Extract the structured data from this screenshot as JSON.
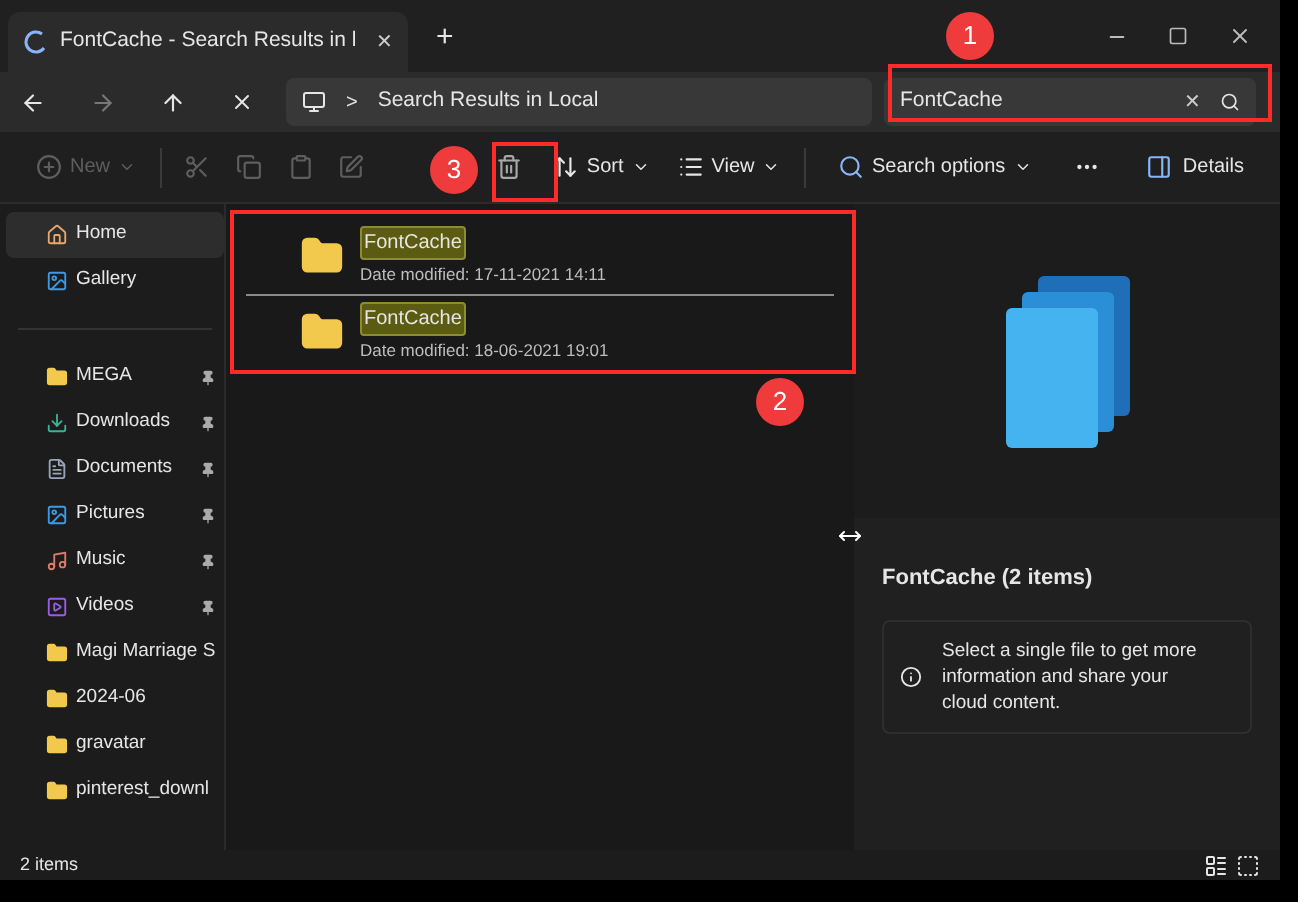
{
  "tab": {
    "title": "FontCache - Search Results in l",
    "close": "✕",
    "new_tab": "+"
  },
  "address": {
    "path": "Search Results in Local",
    "separator": ">"
  },
  "search": {
    "value": "FontCache",
    "clear": "✕"
  },
  "toolbar": [
    {
      "kind": "new",
      "label": "New",
      "disabled": true
    },
    {
      "kind": "cut",
      "disabled": true
    },
    {
      "kind": "copy",
      "disabled": true
    },
    {
      "kind": "paste",
      "disabled": true
    },
    {
      "kind": "rename",
      "disabled": true
    },
    {
      "kind": "delete",
      "disabled": false
    },
    {
      "kind": "sort",
      "label": "Sort",
      "disabled": false
    },
    {
      "kind": "view",
      "label": "View",
      "disabled": false
    },
    {
      "kind": "search_options",
      "label": "Search options",
      "disabled": false
    },
    {
      "kind": "more",
      "disabled": false
    }
  ],
  "details_button": "Details",
  "sidebar": {
    "items": [
      {
        "kind": "home",
        "label": "Home",
        "selected": true,
        "pinned": false
      },
      {
        "kind": "gallery",
        "label": "Gallery",
        "selected": false,
        "pinned": false
      },
      {
        "kind": "divider"
      },
      {
        "kind": "folder",
        "label": "MEGA",
        "selected": false,
        "pinned": true
      },
      {
        "kind": "downloads",
        "label": "Downloads",
        "selected": false,
        "pinned": true
      },
      {
        "kind": "documents",
        "label": "Documents",
        "selected": false,
        "pinned": true
      },
      {
        "kind": "pictures",
        "label": "Pictures",
        "selected": false,
        "pinned": true
      },
      {
        "kind": "music",
        "label": "Music",
        "selected": false,
        "pinned": true
      },
      {
        "kind": "videos",
        "label": "Videos",
        "selected": false,
        "pinned": true
      },
      {
        "kind": "folder",
        "label": "Magi Marriage S",
        "selected": false,
        "pinned": false
      },
      {
        "kind": "folder",
        "label": "2024-06",
        "selected": false,
        "pinned": false
      },
      {
        "kind": "folder",
        "label": "gravatar",
        "selected": false,
        "pinned": false
      },
      {
        "kind": "folder",
        "label": "pinterest_downl",
        "selected": false,
        "pinned": false
      }
    ]
  },
  "results": [
    {
      "name": "FontCache",
      "date": "Date modified: 17-11-2021 14:11"
    },
    {
      "name": "FontCache",
      "date": "Date modified: 18-06-2021 19:01"
    }
  ],
  "details": {
    "title": "FontCache (2 items)",
    "info": "Select a single file to get more information and share your cloud content."
  },
  "status_bar": {
    "count": "2 items"
  },
  "annotations": [
    {
      "number": "1"
    },
    {
      "number": "2"
    },
    {
      "number": "3"
    }
  ]
}
